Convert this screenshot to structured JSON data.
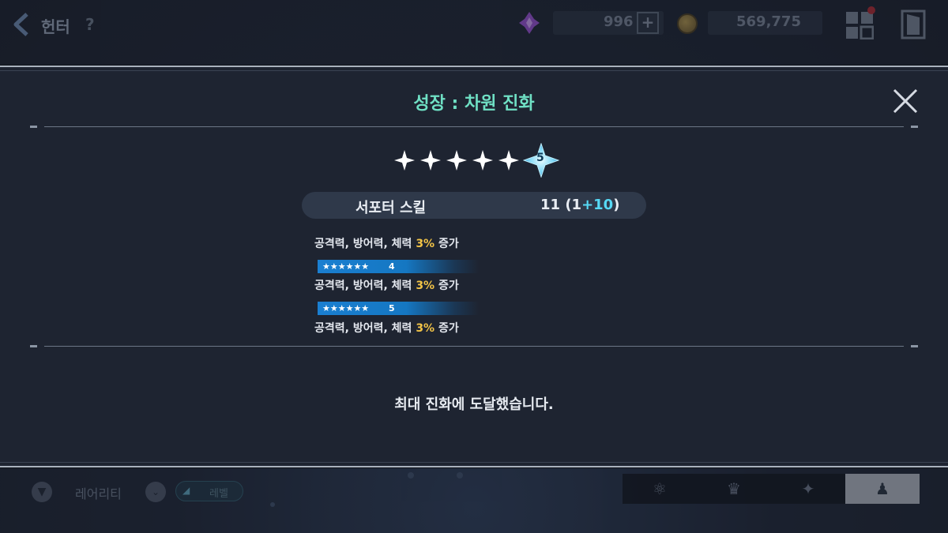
{
  "topbar": {
    "title": "헌터",
    "help": "?",
    "gems": "996",
    "plus": "+",
    "gold": "569,775"
  },
  "bottombar": {
    "rarity_label": "레어리티",
    "level_label": "레벨"
  },
  "modal": {
    "title": "성장 : 차원 진화",
    "star_count": 5,
    "evolution_badge": "5",
    "skill": {
      "name": "서포터 스킬",
      "level_base": "11 (1",
      "level_bonus": "+10",
      "level_close": ")"
    },
    "effects": [
      {
        "prefix": "공격력, 방어력, 체력 ",
        "percent": "3%",
        "suffix": " 증가"
      },
      {
        "prefix": "공격력, 방어력, 체력 ",
        "percent": "3%",
        "suffix": " 증가"
      },
      {
        "prefix": "공격력, 방어력, 체력 ",
        "percent": "3%",
        "suffix": " 증가"
      }
    ],
    "tiers": [
      {
        "stars": "★★★★★★",
        "num": "4"
      },
      {
        "stars": "★★★★★★",
        "num": "5"
      }
    ],
    "max_message": "최대 진화에 도달했습니다."
  },
  "colors": {
    "title_accent": "#6fe0c4",
    "bonus_accent": "#56d9f5",
    "percent_accent": "#f1c347",
    "tier_bar": "#1a7fd1"
  }
}
